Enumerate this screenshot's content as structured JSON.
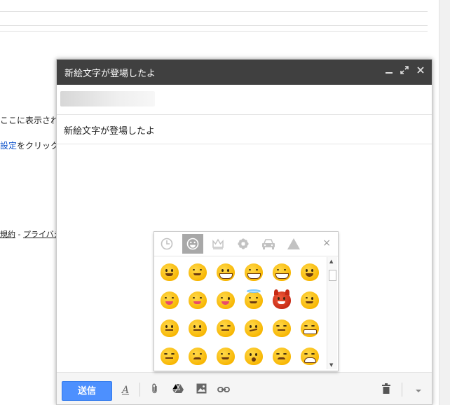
{
  "background": {
    "snippet_1": "ここに表示され",
    "snippet_2_link": "設定",
    "snippet_2_text": "をクリックし",
    "footer_terms": "規約",
    "footer_sep": " - ",
    "footer_privacy": "プライバシ"
  },
  "compose": {
    "title": "新絵文字が登場したよ",
    "subject": "新絵文字が登場したよ",
    "minimize_icon": "minimize-icon",
    "expand_icon": "expand-icon",
    "close_icon": "close-icon"
  },
  "toolbar": {
    "send_label": "送信",
    "format_glyph": "A",
    "emoji_glyph": "☻"
  },
  "picker": {
    "tabs": [
      "clock-icon",
      "smiley-icon",
      "crown-icon",
      "flower-icon",
      "car-icon",
      "triangle-icon"
    ],
    "active_tab": "smiley-icon",
    "close_glyph": "×"
  },
  "colors": {
    "header_bg": "#404040",
    "send_button": "#4d90fe",
    "highlight": "#ff0000",
    "emoji_yellow": "#f7b500"
  }
}
